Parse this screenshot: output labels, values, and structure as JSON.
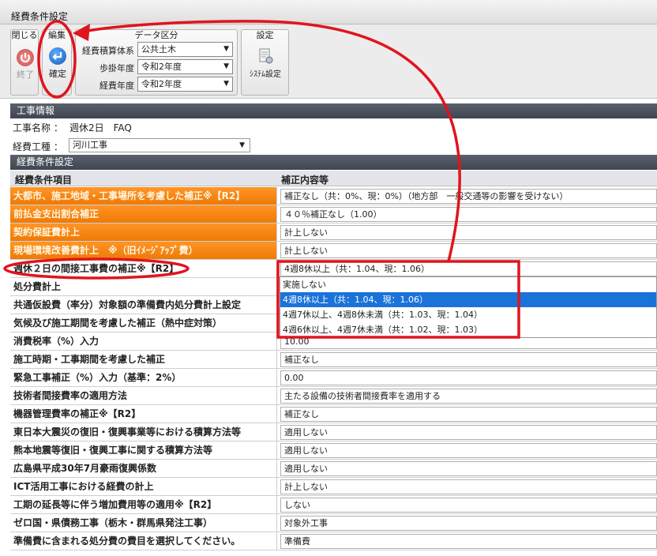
{
  "window": {
    "title": "経費条件設定"
  },
  "toolbar": {
    "close_group": "閉じる",
    "exit_label": "終了",
    "edit_group": "編集",
    "confirm_label": "確定",
    "data_group": "データ区分",
    "fields": [
      {
        "label": "経費積算体系",
        "value": "公共土木"
      },
      {
        "label": "歩掛年度",
        "value": "令和2年度"
      },
      {
        "label": "経費年度",
        "value": "令和2年度"
      }
    ],
    "settings_group": "設定",
    "system_settings_label": "ｼｽﾃﾑ設定"
  },
  "project": {
    "section_title": "工事情報",
    "name_label": "工事名称 ：",
    "name_value": "週休2日　FAQ",
    "type_label": "経費工種 ：",
    "type_value": "河川工事"
  },
  "conditions": {
    "section_title": "経費条件設定",
    "col_item": "経費条件項目",
    "col_value": "補正内容等",
    "rows": [
      {
        "label": "大都市、施工地域・工事場所を考慮した補正※【R2】",
        "value": "補正なし（共：0%、現：0%）（地方部　一般交通等の影響を受けない）"
      },
      {
        "label": "前払金支出割合補正",
        "value": "４０％補正なし（1.00）"
      },
      {
        "label": "契約保証費計上",
        "value": "計上しない"
      },
      {
        "label": "現場環境改善費計上　※（旧ｲﾒｰｼﾞｱｯﾌﾟ費）",
        "value": "計上しない"
      },
      {
        "label": "週休２日の間接工事費の補正※【R2】",
        "value": "4週8休以上（共：1.04、現：1.06）"
      },
      {
        "label": "処分費計上",
        "value": ""
      },
      {
        "label": "共通仮設費（率分）対象額の準備費内処分費計上設定",
        "value": ""
      },
      {
        "label": "気候及び施工期間を考慮した補正（熱中症対策）",
        "value": ""
      },
      {
        "label": "消費税率（%）入力",
        "value": "10.00"
      },
      {
        "label": "施工時期・工事期間を考慮した補正",
        "value": "補正なし"
      },
      {
        "label": "緊急工事補正（%）入力（基準：2%）",
        "value": "0.00"
      },
      {
        "label": "技術者間接費率の適用方法",
        "value": "主たる設備の技術者間接費率を適用する"
      },
      {
        "label": "機器管理費率の補正※【R2】",
        "value": "補正なし"
      },
      {
        "label": "東日本大震災の復旧・復興事業等における積算方法等",
        "value": "適用しない"
      },
      {
        "label": "熊本地震等復旧・復興工事に関する積算方法等",
        "value": "適用しない"
      },
      {
        "label": "広島県平成30年7月豪雨復興係数",
        "value": "適用しない"
      },
      {
        "label": "ICT活用工事における経費の計上",
        "value": "計上しない"
      },
      {
        "label": "工期の延長等に伴う増加費用等の適用※【R2】",
        "value": "しない"
      },
      {
        "label": "ゼロ国・県債務工事（栃木・群馬県発注工事）",
        "value": "対象外工事"
      },
      {
        "label": "準備費に含まれる処分費の費目を選択してください。",
        "value": "準備費"
      }
    ],
    "dropdown_options": [
      "実施しない",
      "4週8休以上（共：1.04、現：1.06）",
      "4週7休以上、4週8休未満（共：1.03、現：1.04）",
      "4週6休以上、4週7休未満（共：1.02、現：1.03）"
    ]
  },
  "colors": {
    "orange_row": "#f08000",
    "selected_option": "#1a73d9",
    "annotation": "#e0141e"
  }
}
